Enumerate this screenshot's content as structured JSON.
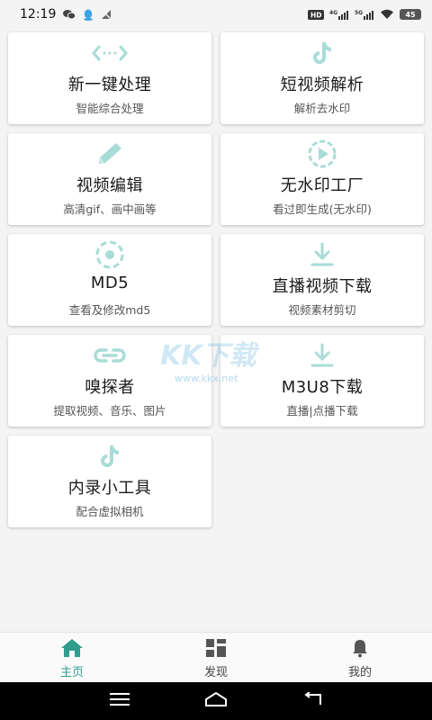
{
  "status_bar": {
    "time": "12:19",
    "left_icons": [
      "wechat-icon",
      "qq-icon",
      "no-signal-icon"
    ],
    "right_icons": [
      "hd-icon",
      "signal-4g-icon",
      "signal-5g-icon",
      "wifi-icon"
    ],
    "battery": "45"
  },
  "cards": [
    {
      "title": "新一键处理",
      "subtitle": "智能综合处理",
      "icon": "code-arrows-icon"
    },
    {
      "title": "短视频解析",
      "subtitle": "解析去水印",
      "icon": "tiktok-icon"
    },
    {
      "title": "视频编辑",
      "subtitle": "高清gif、画中画等",
      "icon": "pencil-icon"
    },
    {
      "title": "无水印工厂",
      "subtitle": "看过即生成(无水印)",
      "icon": "play-circle-icon"
    },
    {
      "title": "MD5",
      "subtitle": "查看及修改md5",
      "icon": "dashed-circle-icon"
    },
    {
      "title": "直播视频下载",
      "subtitle": "视频素材剪切",
      "icon": "download-icon"
    },
    {
      "title": "嗅探者",
      "subtitle": "提取视频、音乐、图片",
      "icon": "link-icon"
    },
    {
      "title": "M3U8下载",
      "subtitle": "直播|点播下载",
      "icon": "download-icon"
    },
    {
      "title": "内录小工具",
      "subtitle": "配合虚拟相机",
      "icon": "tiktok-icon"
    }
  ],
  "watermark": {
    "text": "KK下载",
    "url": "www.kkx.net"
  },
  "bottom_nav": [
    {
      "label": "主页",
      "icon": "home-icon",
      "active": true
    },
    {
      "label": "发现",
      "icon": "grid-icon",
      "active": false
    },
    {
      "label": "我的",
      "icon": "bell-icon",
      "active": false
    }
  ],
  "colors": {
    "accent": "#2f9e8f",
    "icon_tint": "#a9dcd6"
  }
}
